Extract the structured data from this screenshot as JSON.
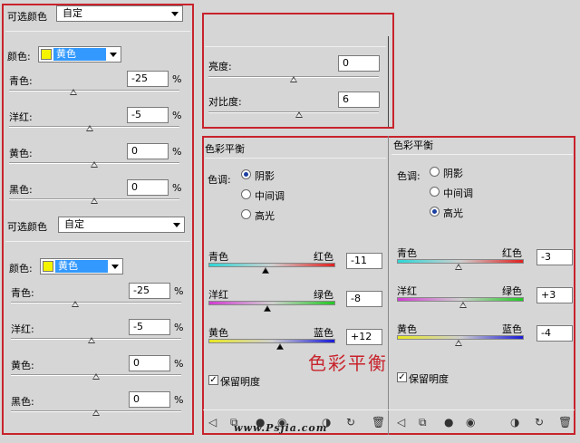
{
  "left_panel": {
    "top": {
      "title": "可选颜色",
      "preset": "自定",
      "color_label": "颜色:",
      "color_value": "黄色",
      "sliders": [
        {
          "label": "青色:",
          "value": "-25",
          "unit": "%",
          "pos": 0.375
        },
        {
          "label": "洋红:",
          "value": "-5",
          "unit": "%",
          "pos": 0.475
        },
        {
          "label": "黄色:",
          "value": "0",
          "unit": "%",
          "pos": 0.5
        },
        {
          "label": "黑色:",
          "value": "0",
          "unit": "%",
          "pos": 0.5
        }
      ]
    },
    "bottom": {
      "title": "可选颜色",
      "preset": "自定",
      "color_label": "颜色:",
      "color_value": "黄色",
      "sliders": [
        {
          "label": "青色:",
          "value": "-25",
          "unit": "%",
          "pos": 0.375
        },
        {
          "label": "洋红:",
          "value": "-5",
          "unit": "%",
          "pos": 0.475
        },
        {
          "label": "黄色:",
          "value": "0",
          "unit": "%",
          "pos": 0.5
        },
        {
          "label": "黑色:",
          "value": "0",
          "unit": "%",
          "pos": 0.5
        }
      ]
    }
  },
  "brightness_panel": {
    "brightness_label": "亮度:",
    "brightness_value": "0",
    "contrast_label": "对比度:",
    "contrast_value": "6"
  },
  "color_balance_1": {
    "title": "色彩平衡",
    "tone_label": "色调:",
    "tones": [
      "阴影",
      "中间调",
      "高光"
    ],
    "selected": 0,
    "rows": [
      {
        "left": "青色",
        "right": "红色",
        "value": "-11"
      },
      {
        "left": "洋红",
        "right": "绿色",
        "value": "-8"
      },
      {
        "left": "黄色",
        "right": "蓝色",
        "value": "+12"
      }
    ],
    "preserve": "保留明度",
    "caption": "色彩平衡"
  },
  "color_balance_2": {
    "title": "色彩平衡",
    "tone_label": "色调:",
    "tones": [
      "阴影",
      "中间调",
      "高光"
    ],
    "selected": 2,
    "rows": [
      {
        "left": "青色",
        "right": "红色",
        "value": "-3"
      },
      {
        "left": "洋红",
        "right": "绿色",
        "value": "+3"
      },
      {
        "left": "黄色",
        "right": "蓝色",
        "value": "-4"
      }
    ],
    "preserve": "保留明度"
  },
  "watermark": "www.Psjia.com",
  "colors": {
    "frame": "#c8232c",
    "swatch": "#f4f400",
    "highlight": "#3399ff"
  }
}
